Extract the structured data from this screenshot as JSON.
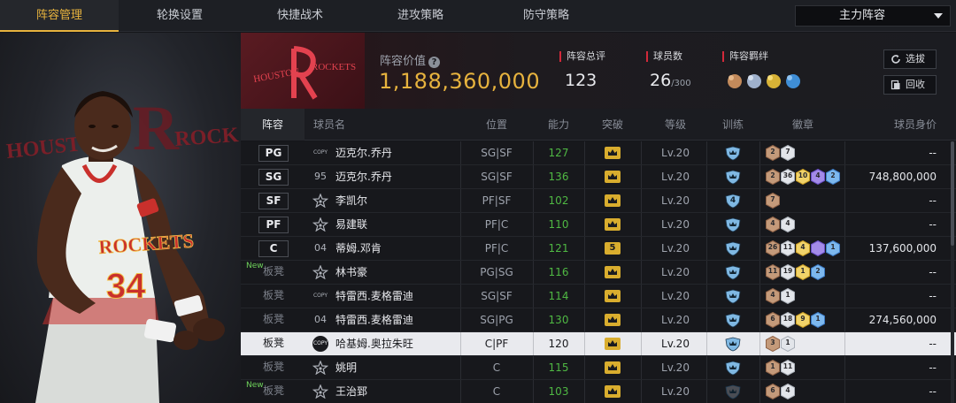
{
  "nav": {
    "tabs": [
      {
        "label": "阵容管理",
        "active": true
      },
      {
        "label": "轮换设置",
        "active": false
      },
      {
        "label": "快捷战术",
        "active": false
      },
      {
        "label": "进攻策略",
        "active": false
      },
      {
        "label": "防守策略",
        "active": false
      }
    ],
    "lineup_select": "主力阵容"
  },
  "player_art": {
    "jersey_text": "ROCKETS",
    "jersey_number": "34",
    "bg_text": "HOUSTON ROCKETS"
  },
  "team": {
    "logo_text": "HOUSTON ROCKETS",
    "value_label": "阵容价值",
    "value": "1,188,360,000",
    "rating_label": "阵容总评",
    "rating": "123",
    "count_label": "球员数",
    "count": "26",
    "count_max": "/300",
    "bond_label": "阵容羁绊",
    "select_btn": "选拔",
    "recycle_btn": "回收"
  },
  "colors": {
    "accent": "#e7b33e",
    "ability_green": "#4fb843",
    "team_red": "#d2293a",
    "new_tag": "#6fd35b"
  },
  "table": {
    "headers": [
      "阵容",
      "球员名",
      "位置",
      "能力",
      "突破",
      "等级",
      "训练",
      "徽章",
      "球员身价"
    ],
    "rows": [
      {
        "slot": "PG",
        "bench": false,
        "new": false,
        "card": "COPY",
        "name": "迈克尔.乔丹",
        "position": "SG|SF",
        "ability": "127",
        "breakthrough": "",
        "level": "Lv.20",
        "training": "",
        "badges": [
          {
            "n": "2",
            "c": "bronze"
          },
          {
            "n": "7",
            "c": "silver"
          }
        ],
        "price": "--"
      },
      {
        "slot": "SG",
        "bench": false,
        "new": false,
        "card": "95",
        "name": "迈克尔.乔丹",
        "position": "SG|SF",
        "ability": "136",
        "breakthrough": "",
        "level": "Lv.20",
        "training": "",
        "badges": [
          {
            "n": "2",
            "c": "bronze"
          },
          {
            "n": "36",
            "c": "silver"
          },
          {
            "n": "10",
            "c": "gold"
          },
          {
            "n": "4",
            "c": "purple"
          },
          {
            "n": "2",
            "c": "blue"
          }
        ],
        "price": "748,800,000"
      },
      {
        "slot": "SF",
        "bench": false,
        "new": false,
        "card": "star",
        "name": "李凯尔",
        "position": "PF|SF",
        "ability": "102",
        "breakthrough": "",
        "level": "Lv.20",
        "training": "4",
        "badges": [
          {
            "n": "7",
            "c": "bronze"
          }
        ],
        "price": "--"
      },
      {
        "slot": "PF",
        "bench": false,
        "new": false,
        "card": "star",
        "name": "易建联",
        "position": "PF|C",
        "ability": "110",
        "breakthrough": "",
        "level": "Lv.20",
        "training": "",
        "badges": [
          {
            "n": "4",
            "c": "bronze"
          },
          {
            "n": "4",
            "c": "silver"
          }
        ],
        "price": "--"
      },
      {
        "slot": "C",
        "bench": false,
        "new": false,
        "card": "04",
        "name": "蒂姆.邓肯",
        "position": "PF|C",
        "ability": "121",
        "breakthrough": "5",
        "level": "Lv.20",
        "training": "",
        "badges": [
          {
            "n": "26",
            "c": "bronze"
          },
          {
            "n": "11",
            "c": "silver"
          },
          {
            "n": "4",
            "c": "gold"
          },
          {
            "n": "",
            "c": "purple"
          },
          {
            "n": "1",
            "c": "blue"
          }
        ],
        "price": "137,600,000"
      },
      {
        "slot": "板凳",
        "bench": true,
        "new": true,
        "card": "star",
        "name": "林书豪",
        "position": "PG|SG",
        "ability": "116",
        "breakthrough": "",
        "level": "Lv.20",
        "training": "",
        "badges": [
          {
            "n": "11",
            "c": "bronze"
          },
          {
            "n": "19",
            "c": "silver"
          },
          {
            "n": "1",
            "c": "gold"
          },
          {
            "n": "2",
            "c": "blue"
          }
        ],
        "price": "--"
      },
      {
        "slot": "板凳",
        "bench": true,
        "new": false,
        "card": "COPY",
        "name": "特雷西.麦格雷迪",
        "position": "SG|SF",
        "ability": "114",
        "breakthrough": "",
        "level": "Lv.20",
        "training": "",
        "badges": [
          {
            "n": "4",
            "c": "bronze"
          },
          {
            "n": "1",
            "c": "silver"
          }
        ],
        "price": "--"
      },
      {
        "slot": "板凳",
        "bench": true,
        "new": false,
        "card": "04",
        "name": "特雷西.麦格雷迪",
        "position": "SG|PG",
        "ability": "130",
        "breakthrough": "",
        "level": "Lv.20",
        "training": "",
        "badges": [
          {
            "n": "6",
            "c": "bronze"
          },
          {
            "n": "18",
            "c": "silver"
          },
          {
            "n": "9",
            "c": "gold"
          },
          {
            "n": "1",
            "c": "blue"
          }
        ],
        "price": "274,560,000"
      },
      {
        "slot": "板凳",
        "bench": true,
        "new": false,
        "card": "COPY",
        "name": "哈基姆.奥拉朱旺",
        "position": "C|PF",
        "ability": "120",
        "breakthrough": "",
        "level": "Lv.20",
        "training": "",
        "badges": [
          {
            "n": "3",
            "c": "bronze"
          },
          {
            "n": "1",
            "c": "silver"
          }
        ],
        "price": "--",
        "selected": true
      },
      {
        "slot": "板凳",
        "bench": true,
        "new": false,
        "card": "star",
        "name": "姚明",
        "position": "C",
        "ability": "115",
        "breakthrough": "",
        "level": "Lv.20",
        "training": "",
        "badges": [
          {
            "n": "1",
            "c": "bronze"
          },
          {
            "n": "11",
            "c": "silver"
          }
        ],
        "price": "--"
      },
      {
        "slot": "板凳",
        "bench": true,
        "new": true,
        "card": "star",
        "name": "王治郅",
        "position": "C",
        "ability": "103",
        "breakthrough": "",
        "level": "Lv.20",
        "training": "",
        "badges": [
          {
            "n": "6",
            "c": "bronze"
          },
          {
            "n": "4",
            "c": "silver"
          }
        ],
        "price": "--",
        "training_dim": true
      }
    ]
  }
}
